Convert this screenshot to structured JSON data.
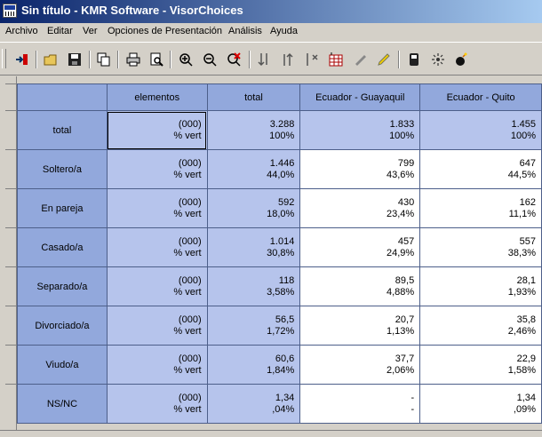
{
  "window": {
    "title": "Sin título - KMR Software - VisorChoices"
  },
  "menu": [
    "Archivo",
    "Editar",
    "Ver",
    "Opciones de Presentación",
    "Análisis",
    "Ayuda"
  ],
  "toolbar_icons": [
    "exit-icon",
    "open-icon",
    "save-icon",
    "copy-icon",
    "print-icon",
    "print-preview-icon",
    "zoom-in-icon",
    "zoom-out-icon",
    "zoom-reset-icon",
    "sort-desc-icon",
    "sort-asc-icon",
    "remove-column-icon",
    "table-grid-icon",
    "tools-icon",
    "highlight-icon",
    "export-icon",
    "settings-icon",
    "bomb-icon"
  ],
  "table": {
    "headers": [
      "elementos",
      "total",
      "Ecuador - Guayaquil",
      "Ecuador - Quito"
    ],
    "type_top": "(000)",
    "type_bottom": "% vert",
    "rows": [
      {
        "label": "total",
        "total": [
          "3.288",
          "100%"
        ],
        "gye": [
          "1.833",
          "100%"
        ],
        "uio": [
          "1.455",
          "100%"
        ]
      },
      {
        "label": "Soltero/a",
        "total": [
          "1.446",
          "44,0%"
        ],
        "gye": [
          "799",
          "43,6%"
        ],
        "uio": [
          "647",
          "44,5%"
        ]
      },
      {
        "label": "En pareja",
        "total": [
          "592",
          "18,0%"
        ],
        "gye": [
          "430",
          "23,4%"
        ],
        "uio": [
          "162",
          "11,1%"
        ]
      },
      {
        "label": "Casado/a",
        "total": [
          "1.014",
          "30,8%"
        ],
        "gye": [
          "457",
          "24,9%"
        ],
        "uio": [
          "557",
          "38,3%"
        ]
      },
      {
        "label": "Separado/a",
        "total": [
          "118",
          "3,58%"
        ],
        "gye": [
          "89,5",
          "4,88%"
        ],
        "uio": [
          "28,1",
          "1,93%"
        ]
      },
      {
        "label": "Divorciado/a",
        "total": [
          "56,5",
          "1,72%"
        ],
        "gye": [
          "20,7",
          "1,13%"
        ],
        "uio": [
          "35,8",
          "2,46%"
        ]
      },
      {
        "label": "Viudo/a",
        "total": [
          "60,6",
          "1,84%"
        ],
        "gye": [
          "37,7",
          "2,06%"
        ],
        "uio": [
          "22,9",
          "1,58%"
        ]
      },
      {
        "label": "NS/NC",
        "total": [
          "1,34",
          ",04%"
        ],
        "gye": [
          "-",
          "-"
        ],
        "uio": [
          "1,34",
          ",09%"
        ]
      }
    ]
  }
}
